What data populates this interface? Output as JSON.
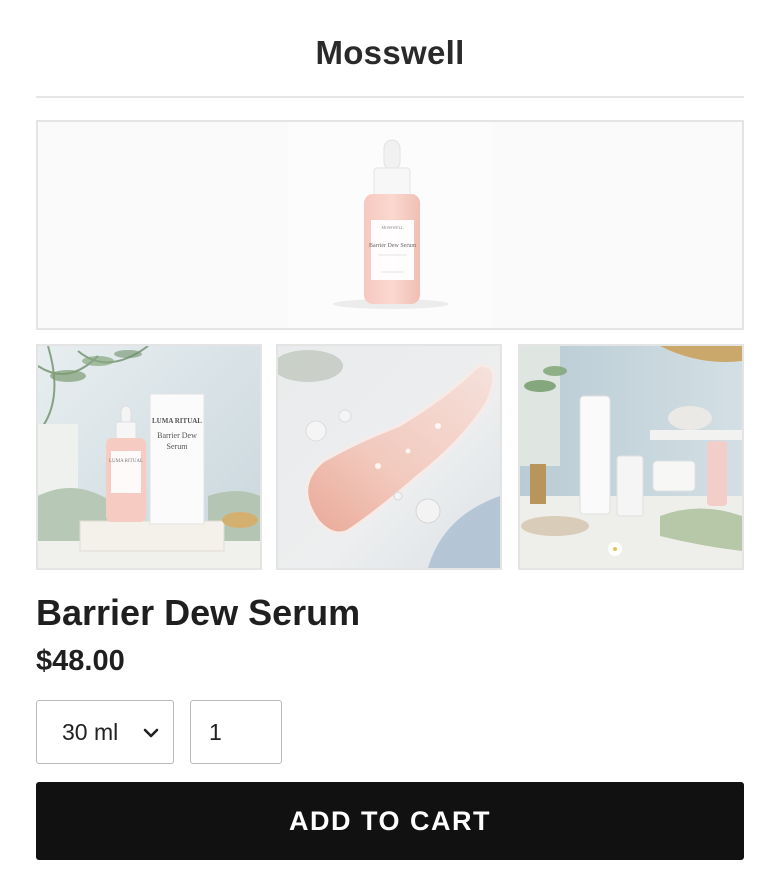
{
  "header": {
    "brand": "Mosswell"
  },
  "hero": {
    "image_name": "product-hero-image",
    "bottle_label": "Barrier Dew Serum",
    "bottle_brand": "MOSSWELL"
  },
  "gallery": [
    {
      "name": "thumbnail-bottle-with-box",
      "box_brand": "LUMA RITUAL",
      "box_title_1": "Barrier Dew",
      "box_title_2": "Serum",
      "bottle_brand": "LUMA RITUAL"
    },
    {
      "name": "thumbnail-serum-texture"
    },
    {
      "name": "thumbnail-bathroom-shelf"
    }
  ],
  "product": {
    "title": "Barrier Dew Serum",
    "price": "$48.00"
  },
  "options": {
    "size_selected": "30 ml",
    "quantity": "1"
  },
  "actions": {
    "add_to_cart_label": "ADD TO CART"
  },
  "colors": {
    "button_bg": "#111111",
    "serum_pink": "#f4c4bc",
    "border": "#e4e4e4"
  }
}
